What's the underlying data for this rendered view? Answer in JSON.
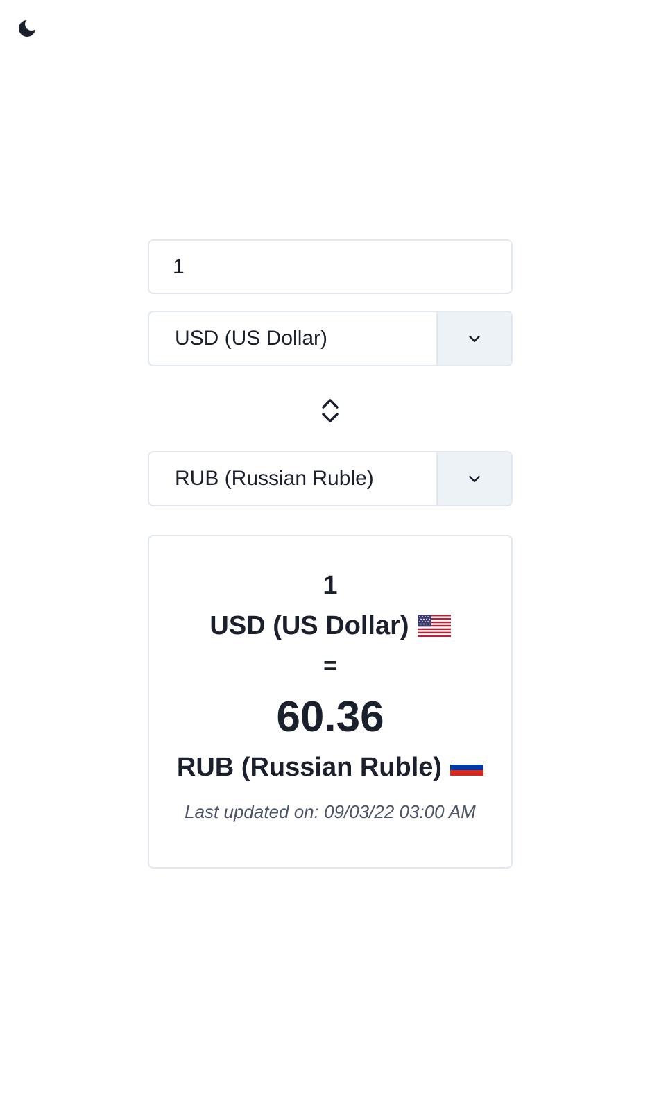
{
  "header": {
    "theme_toggle_icon": "moon-icon"
  },
  "converter": {
    "amount_value": "1",
    "from_currency": {
      "label": "USD (US Dollar)",
      "icon": "chevron-down-icon"
    },
    "swap_icon": "swap-vertical-icon",
    "to_currency": {
      "label": "RUB (Russian Ruble)",
      "icon": "chevron-down-icon"
    }
  },
  "result": {
    "amount": "1",
    "from_label": "USD (US Dollar)",
    "from_flag": "us-flag-icon",
    "equals": "=",
    "value": "60.36",
    "to_label": "RUB (Russian Ruble)",
    "to_flag": "ru-flag-icon",
    "last_updated": "Last updated on: 09/03/22 03:00 AM"
  },
  "colors": {
    "text": "#1a202c",
    "border": "#e2e8f0",
    "addon_bg": "#edf2f7",
    "muted": "#4a5568"
  }
}
